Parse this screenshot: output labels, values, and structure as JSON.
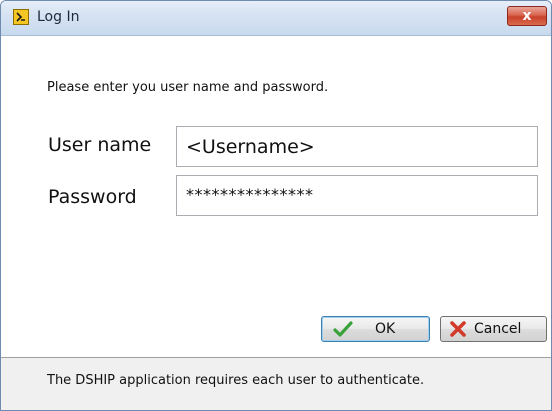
{
  "window": {
    "title": "Log In",
    "title_icon": "labview-app-icon",
    "close_label": "x"
  },
  "form": {
    "instruction": "Please enter you user name and password.",
    "username_label": "User name",
    "username_value": "<Username>",
    "password_label": "Password",
    "password_value": "***************"
  },
  "buttons": {
    "ok_label": "OK",
    "ok_icon": "checkmark-icon",
    "cancel_label": "Cancel",
    "cancel_icon": "red-x-icon"
  },
  "status": {
    "text": "The DSHIP application requires each user to authenticate."
  },
  "colors": {
    "titlebar": "#d5e2f2",
    "close_button": "#c8412a",
    "ok_check": "#3aa23a",
    "cancel_x": "#d23a2a",
    "status_bar": "#f0f0f0"
  }
}
